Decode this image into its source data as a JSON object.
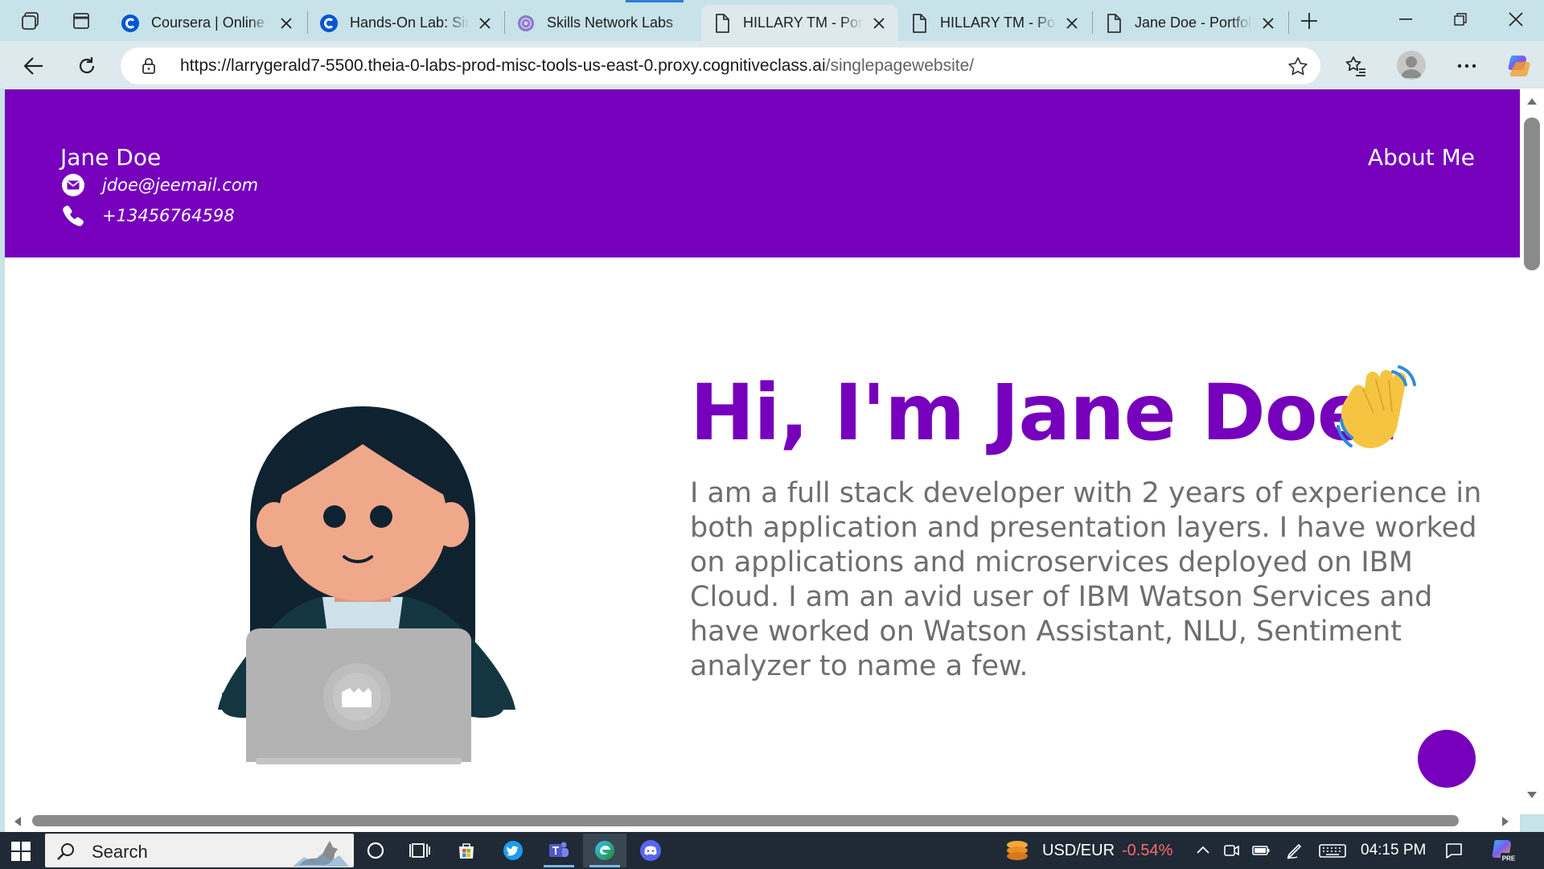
{
  "browser": {
    "tabs": [
      {
        "title": "Coursera | Online Courses & Credentials From Top Educators",
        "favicon": "coursera-icon"
      },
      {
        "title": "Hands-On Lab: Single Page Website",
        "favicon": "coursera-icon"
      },
      {
        "title": "Skills Network Labs",
        "favicon": "skills-network-icon"
      },
      {
        "title": "HILLARY TM - Portfolio",
        "favicon": "page-icon",
        "active": true
      },
      {
        "title": "HILLARY TM - Portfolio",
        "favicon": "page-icon"
      },
      {
        "title": "Jane Doe - Portfolio",
        "favicon": "page-icon"
      }
    ],
    "address": {
      "url_host": "https://larrygerald7-5500.theia-0-labs-prod-misc-tools-us-east-0.proxy.cognitiveclass.ai",
      "url_path": "/singlepagewebsite/"
    },
    "colors": {
      "chrome": "#c7e2e8",
      "toolbar": "#dde9ec"
    }
  },
  "page": {
    "header": {
      "name": "Jane Doe",
      "email": "jdoe@jeemail.com",
      "phone": "+13456764598",
      "nav_about": "About Me",
      "email_icon": "envelope-icon",
      "phone_icon": "phone-icon"
    },
    "hero": {
      "title": "Hi, I'm Jane Doe!",
      "wave_icon": "waving-hand-icon",
      "description": "I am a full stack developer with 2 years of experience in both application and presentation layers. I have worked on applications and microservices deployed on IBM Cloud. I am an avid user of IBM Watson Services and have worked on Watson Assistant, NLU, Sentiment analyzer to name a few."
    },
    "colors": {
      "brand": "#7600bc",
      "text_muted": "#6e6e6e",
      "background": "#ffffff"
    }
  },
  "taskbar": {
    "search_placeholder": "Search",
    "currency_label": "USD/EUR",
    "currency_change": "-0.54%",
    "currency_change_color": "#ff6b6b",
    "time": "04:15 PM"
  }
}
